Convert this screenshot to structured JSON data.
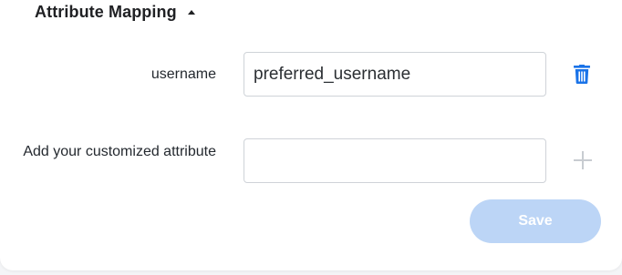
{
  "section": {
    "title": "Attribute Mapping",
    "expanded": true
  },
  "mapping_rows": [
    {
      "label": "username",
      "value": "preferred_username",
      "action_icon": "trash-icon",
      "action_color": "#1a73e8"
    }
  ],
  "custom_attribute": {
    "label": "Add your customized attribute",
    "value": "",
    "action_icon": "plus-icon"
  },
  "footer": {
    "save_label": "Save",
    "save_enabled": false,
    "save_color": "#bcd5f6"
  }
}
